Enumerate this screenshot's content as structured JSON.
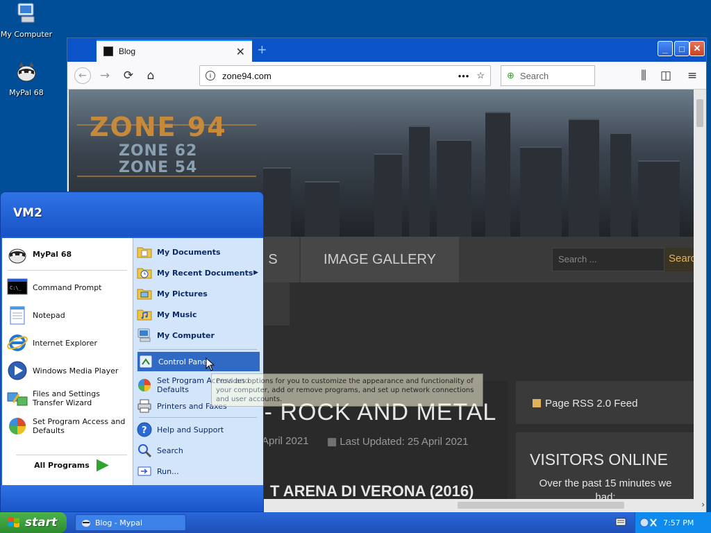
{
  "desktop": {
    "icons": [
      {
        "label": "My Computer"
      },
      {
        "label": "MyPal 68"
      }
    ]
  },
  "browser": {
    "tab_title": "Blog",
    "tab_close": "✕",
    "new_tab": "+",
    "url": "zone94.com",
    "url_more": "•••",
    "search_placeholder": "Search",
    "window_buttons": {
      "minimize": "_",
      "maximize": "□",
      "close": "✕"
    }
  },
  "page": {
    "logo_main": "ZONE 94",
    "logo_sub1": "ZONE 62",
    "logo_sub2": "ZONE 54",
    "menu_partial": "S",
    "menu_gallery": "IMAGE GALLERY",
    "search_placeholder": "Search ...",
    "search_button": "Searc",
    "article_title": "USIC - ROCK AND METAL",
    "article_date": "April 2021",
    "article_updated": "Last Updated: 25 April 2021",
    "article_sub": "T ARENA DI VERONA (2016)",
    "rss_label": "Page RSS 2.0 Feed",
    "visitors_title": "VISITORS ONLINE",
    "visitors_text": "Over the past 15 minutes we had:"
  },
  "start_menu": {
    "username": "VM2",
    "pinned": [
      {
        "label": "MyPal 68"
      }
    ],
    "recent": [
      {
        "label": "Command Prompt"
      },
      {
        "label": "Notepad"
      },
      {
        "label": "Internet Explorer"
      },
      {
        "label": "Windows Media Player"
      },
      {
        "label": "Files and Settings Transfer Wizard"
      },
      {
        "label": "Set Program Access and Defaults"
      }
    ],
    "all_programs": "All Programs",
    "right": [
      {
        "label": "My Documents"
      },
      {
        "label": "My Recent Documents"
      },
      {
        "label": "My Pictures"
      },
      {
        "label": "My Music"
      },
      {
        "label": "My Computer"
      },
      {
        "label": "Control Panel"
      },
      {
        "label": "Set Program Access and Defaults"
      },
      {
        "label": "Printers and Faxes"
      },
      {
        "label": "Help and Support"
      },
      {
        "label": "Search"
      },
      {
        "label": "Run..."
      }
    ],
    "tooltip": "Provides options for you to customize the appearance and functionality of your computer, add or remove programs, and set up network connections and user accounts."
  },
  "taskbar": {
    "start_label": "start",
    "task_label": "Blog - Mypal",
    "clock": "7:57 PM"
  },
  "colors": {
    "desktop": "#004e98",
    "start_green": "#3c9e3c",
    "highlight": "#316ac5"
  }
}
